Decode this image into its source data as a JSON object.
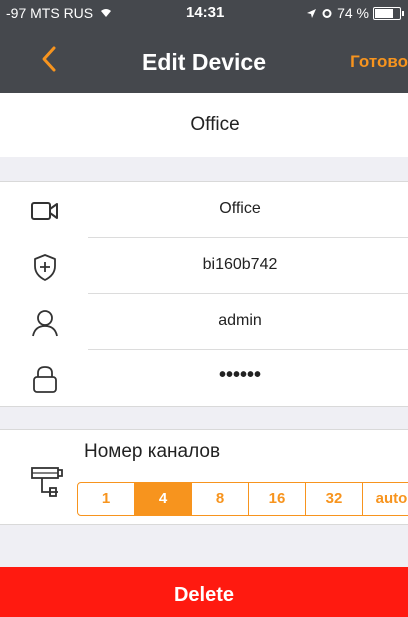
{
  "status_bar": {
    "carrier": "-97 MTS RUS",
    "time": "14:31",
    "battery": "74 %",
    "battery_level": 0.74
  },
  "nav": {
    "title": "Edit Device",
    "done_label": "Готово",
    "back_icon": "chevron-left-icon"
  },
  "device_name": "Office",
  "info": [
    {
      "icon": "camera-icon",
      "value": "Office"
    },
    {
      "icon": "shield-plus-icon",
      "value": "bi160b742"
    },
    {
      "icon": "user-icon",
      "value": "admin"
    },
    {
      "icon": "lock-icon",
      "value": "••••••"
    }
  ],
  "channels": {
    "label": "Номер каналов",
    "icon": "cctv-camera-icon",
    "options": [
      "1",
      "4",
      "8",
      "16",
      "32",
      "auto"
    ],
    "selected": "4"
  },
  "delete_label": "Delete",
  "colors": {
    "accent": "#f7941e",
    "nav_bg": "#45484d",
    "delete_bg": "#ff1a10"
  }
}
